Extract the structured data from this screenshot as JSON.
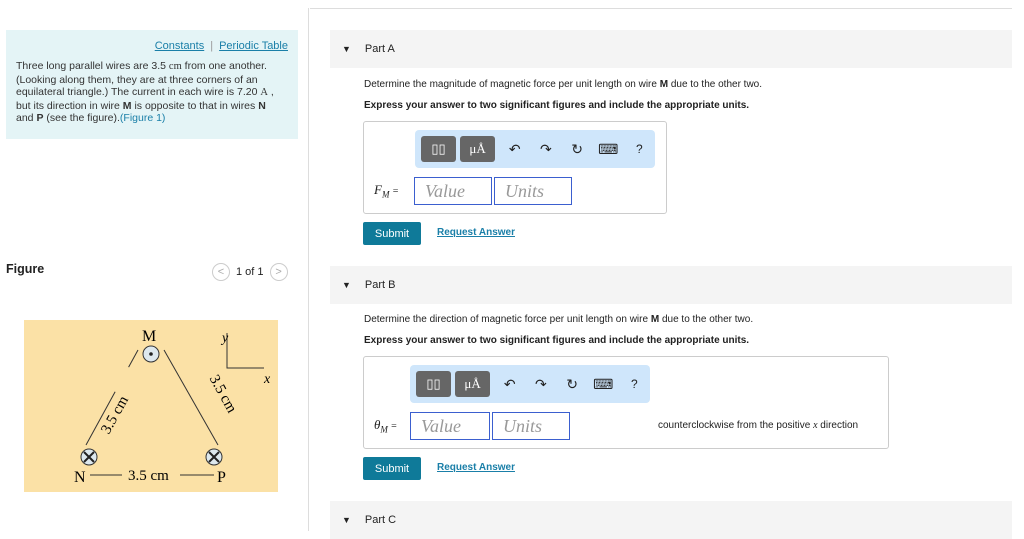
{
  "left": {
    "links": {
      "constants": "Constants",
      "separator": "|",
      "periodic_table": "Periodic Table"
    },
    "problem": {
      "t1": "Three long parallel wires are 3.5 ",
      "unit_cm": "cm",
      "t2": " from one another. (Looking along them, they are at three corners of an equilateral triangle.) The current in each wire is 7.20 ",
      "unit_A": "A",
      "t3": " , but its direction in wire ",
      "M": "M",
      "t4": " is opposite to that in wires ",
      "N": "N",
      "t5": " and ",
      "P": "P",
      "t6": " (see the figure).",
      "figure_link": "(Figure 1)"
    },
    "figure_title": "Figure",
    "pager": {
      "prev": "<",
      "text": "1 of 1",
      "next": ">"
    },
    "figure": {
      "M": "M",
      "N": "N",
      "P": "P",
      "y": "y",
      "x": "x",
      "d_left": "3.5 cm",
      "d_right": "3.5 cm",
      "d_bottom": "3.5 cm"
    }
  },
  "parts": [
    {
      "title": "Part A",
      "question_pre": "Determine the magnitude of magnetic force per unit length on wire ",
      "question_bold": "M",
      "question_post": " due to the other two.",
      "instruction": "Express your answer to two significant figures and include the appropriate units.",
      "label": "F",
      "label_sub": "M",
      "equals": "=",
      "value_placeholder": "Value",
      "units_placeholder": "Units",
      "submit": "Submit",
      "request": "Request Answer"
    },
    {
      "title": "Part B",
      "question_pre": "Determine the direction of magnetic force per unit length on wire ",
      "question_bold": "M",
      "question_post": " due to the other two.",
      "instruction": "Express your answer to two significant figures and include the appropriate units.",
      "label": "θ",
      "label_sub": "M",
      "equals": "=",
      "value_placeholder": "Value",
      "units_placeholder": "Units",
      "suffix_pre": "counterclockwise from the positive ",
      "suffix_var": "x",
      "suffix_post": " direction",
      "submit": "Submit",
      "request": "Request Answer"
    },
    {
      "title": "Part C"
    }
  ],
  "toolbar": {
    "templates": "▯▯",
    "units": "μÅ",
    "undo": "↶",
    "redo": "↷",
    "reset": "↻",
    "keyboard": "⌨",
    "help": "?"
  }
}
